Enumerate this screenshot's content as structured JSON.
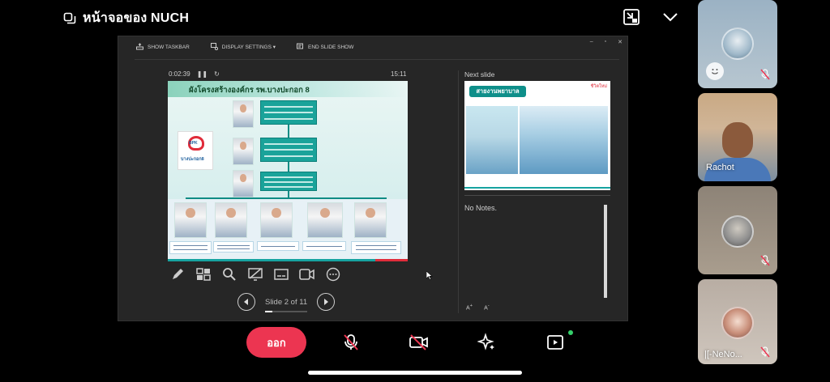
{
  "header": {
    "share_title": "หน้าจอของ NUCH"
  },
  "presenter": {
    "toolbar": {
      "show_taskbar": "SHOW TASKBAR",
      "display_settings": "DISPLAY SETTINGS ▾",
      "end_slide_show": "END SLIDE SHOW"
    },
    "timer": "0:02:39",
    "clock": "15:11",
    "current_slide": {
      "title": "ผังโครงสร้างองค์กร  รพ.บางปะกอก 8",
      "logo_text": "บางปะกอก8",
      "logo_badge": "BPK"
    },
    "slide_counter": "Slide 2 of 11",
    "slide_progress": 0.18,
    "next_slide_label": "Next slide",
    "next_slide": {
      "title": "สายงานพยาบาล",
      "logo": "ชีวิตใหม่"
    },
    "notes": "No Notes."
  },
  "controls": {
    "leave_label": "ออก"
  },
  "participants": [
    {
      "name": ""
    },
    {
      "name": "Rachot"
    },
    {
      "name": ""
    },
    {
      "name": "|[-NeNo..."
    }
  ]
}
